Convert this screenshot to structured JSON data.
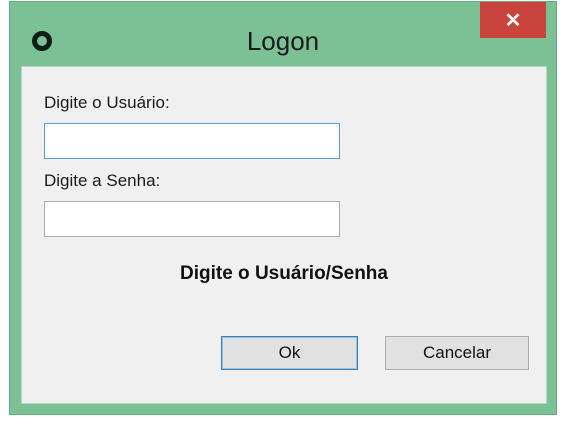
{
  "window": {
    "title": "Logon",
    "close_glyph": "✕",
    "icon": "app-ring-icon",
    "frame_color": "#7cc096",
    "close_color": "#c9443c"
  },
  "form": {
    "user_label": "Digite o Usuário:",
    "user_value": "",
    "password_label": "Digite a Senha:",
    "password_value": "",
    "status_message": "Digite o Usuário/Senha"
  },
  "buttons": {
    "ok_label": "Ok",
    "cancel_label": "Cancelar"
  }
}
